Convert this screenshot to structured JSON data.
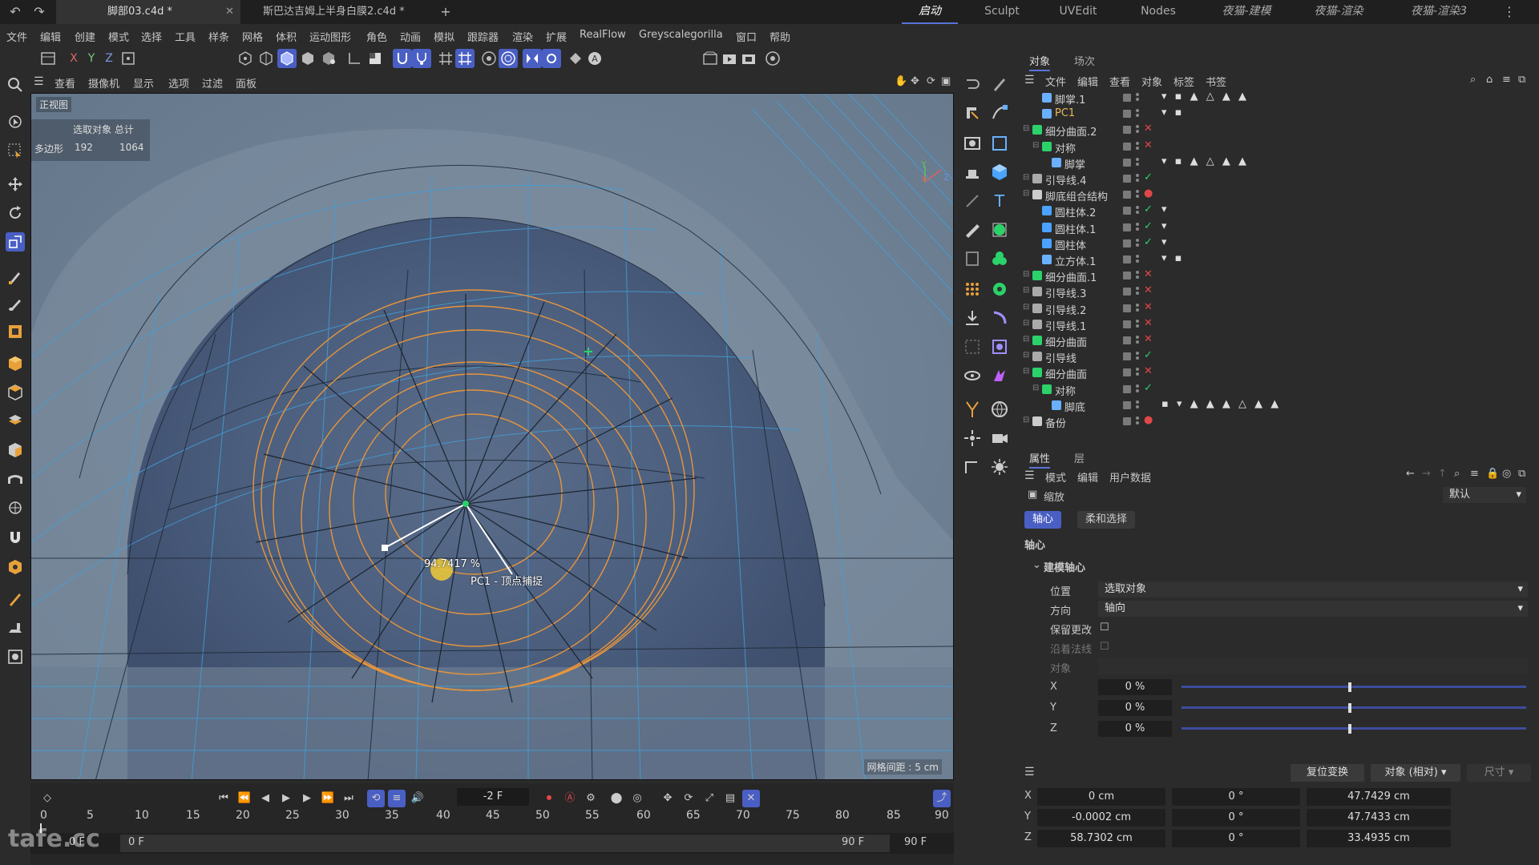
{
  "titlebar": {
    "tabs": [
      {
        "label": "脚部03.c4d *",
        "active": true
      },
      {
        "label": "斯巴达吉姆上半身白膜2.c4d *",
        "active": false
      }
    ],
    "add_tab": "+",
    "layouts": [
      "启动",
      "Sculpt",
      "UVEdit",
      "Nodes",
      "夜猫-建模",
      "夜猫-渲染",
      "夜猫-渲染3"
    ],
    "active_layout": "启动"
  },
  "menubar": [
    "文件",
    "编辑",
    "创建",
    "模式",
    "选择",
    "工具",
    "样条",
    "网格",
    "体积",
    "运动图形",
    "角色",
    "动画",
    "模拟",
    "跟踪器",
    "渲染",
    "扩展",
    "RealFlow",
    "Greyscalegorilla",
    "窗口",
    "帮助"
  ],
  "axis_toggles": [
    "X",
    "Y",
    "Z"
  ],
  "viewport": {
    "menu": [
      "查看",
      "摄像机",
      "显示",
      "选项",
      "过滤",
      "面板"
    ],
    "view_name": "正视图",
    "info_title": "选取对象 总计",
    "info_label": "多边形",
    "info_sel": "192",
    "info_total": "1064",
    "hud_percent": "94.7417 %",
    "hud_snap": "PC1 - 顶点捕捉",
    "grid_note": "网格间距 : 5 cm",
    "axis_x": "X",
    "axis_y": "Y",
    "axis_z": "Z"
  },
  "timeline": {
    "current_frame": "-2 F",
    "ticks": [
      "0",
      "5",
      "10",
      "15",
      "20",
      "25",
      "30",
      "35",
      "40",
      "45",
      "50",
      "55",
      "60",
      "65",
      "70",
      "75",
      "80",
      "85",
      "90"
    ],
    "range_start_a": "0 F",
    "range_start_b": "0 F",
    "range_end_a": "90 F",
    "range_end_b": "90 F"
  },
  "objects": {
    "tabs": [
      "对象",
      "场次"
    ],
    "menu": [
      "文件",
      "编辑",
      "查看",
      "对象",
      "标签",
      "书签"
    ],
    "items": [
      {
        "name": "脚掌.1",
        "indent": 1,
        "icon": "joint",
        "status": "",
        "tags": "▾ ▪ ▲ △ ▲ ▲"
      },
      {
        "name": "PC1",
        "indent": 1,
        "icon": "joint",
        "status": "",
        "tags": "▾ ▪",
        "highlight": true
      },
      {
        "name": "细分曲面.2",
        "indent": 0,
        "icon": "subdiv",
        "status": "✕",
        "tags": ""
      },
      {
        "name": "对称",
        "indent": 1,
        "icon": "symmetry",
        "status": "✕",
        "tags": ""
      },
      {
        "name": "脚掌",
        "indent": 2,
        "icon": "joint",
        "status": "",
        "tags": "▾ ▪ ▲ △ ▲ ▲"
      },
      {
        "name": "引导线.4",
        "indent": 0,
        "icon": "spline",
        "status": "✓",
        "tags": ""
      },
      {
        "name": "脚底组合结构",
        "indent": 0,
        "icon": "null",
        "status": "●",
        "tags": ""
      },
      {
        "name": "圆柱体.2",
        "indent": 1,
        "icon": "cyl",
        "status": "✓",
        "tags": "▾"
      },
      {
        "name": "圆柱体.1",
        "indent": 1,
        "icon": "cyl",
        "status": "✓",
        "tags": "▾"
      },
      {
        "name": "圆柱体",
        "indent": 1,
        "icon": "cyl",
        "status": "✓",
        "tags": "▾"
      },
      {
        "name": "立方体.1",
        "indent": 1,
        "icon": "joint",
        "status": "",
        "tags": "▾ ▪"
      },
      {
        "name": "细分曲面.1",
        "indent": 0,
        "icon": "subdiv",
        "status": "✕",
        "tags": ""
      },
      {
        "name": "引导线.3",
        "indent": 0,
        "icon": "spline",
        "status": "✕",
        "tags": ""
      },
      {
        "name": "引导线.2",
        "indent": 0,
        "icon": "spline",
        "status": "✕",
        "tags": ""
      },
      {
        "name": "引导线.1",
        "indent": 0,
        "icon": "spline",
        "status": "✕",
        "tags": ""
      },
      {
        "name": "细分曲面",
        "indent": 0,
        "icon": "subdiv",
        "status": "✕",
        "tags": ""
      },
      {
        "name": "引导线",
        "indent": 0,
        "icon": "spline",
        "status": "✓",
        "tags": ""
      },
      {
        "name": "细分曲面",
        "indent": 0,
        "icon": "subdiv",
        "status": "✕",
        "tags": ""
      },
      {
        "name": "对称",
        "indent": 1,
        "icon": "symmetry",
        "status": "✓",
        "tags": ""
      },
      {
        "name": "脚底",
        "indent": 2,
        "icon": "joint",
        "status": "",
        "tags": "▪ ▾ ▲ ▲ ▲ △ ▲ ▲"
      },
      {
        "name": "备份",
        "indent": 0,
        "icon": "null",
        "status": "●",
        "tags": ""
      }
    ]
  },
  "attributes": {
    "tabs": [
      "属性",
      "层"
    ],
    "menu": [
      "模式",
      "编辑",
      "用户数据"
    ],
    "tool_name": "缩放",
    "preset": "默认",
    "sub_tabs": [
      "轴心",
      "柔和选择"
    ],
    "section": "轴心",
    "group": "建模轴心",
    "position_label": "位置",
    "position_value": "选取对象",
    "direction_label": "方向",
    "direction_value": "轴向",
    "keep_changes": "保留更改",
    "along_normal": "沿着法线",
    "object_label": "对象",
    "axes": [
      {
        "label": "X",
        "value": "0 %"
      },
      {
        "label": "Y",
        "value": "0 %"
      },
      {
        "label": "Z",
        "value": "0 %"
      }
    ]
  },
  "coordinates": {
    "reset_button": "复位变换",
    "mode_value": "对象 (相对)",
    "size_label": "尺寸",
    "rows": [
      {
        "axis": "X",
        "pos": "0 cm",
        "rot": "0 °",
        "size": "47.7429 cm"
      },
      {
        "axis": "Y",
        "pos": "-0.0002 cm",
        "rot": "0 °",
        "size": "47.7433 cm"
      },
      {
        "axis": "Z",
        "pos": "58.7302 cm",
        "rot": "0 °",
        "size": "33.4935 cm"
      }
    ]
  },
  "watermark": "tafe.cc",
  "colors": {
    "accent": "#4a5fc4",
    "selection_wire": "#e8953a",
    "mesh_wire": "#41a0d8"
  }
}
